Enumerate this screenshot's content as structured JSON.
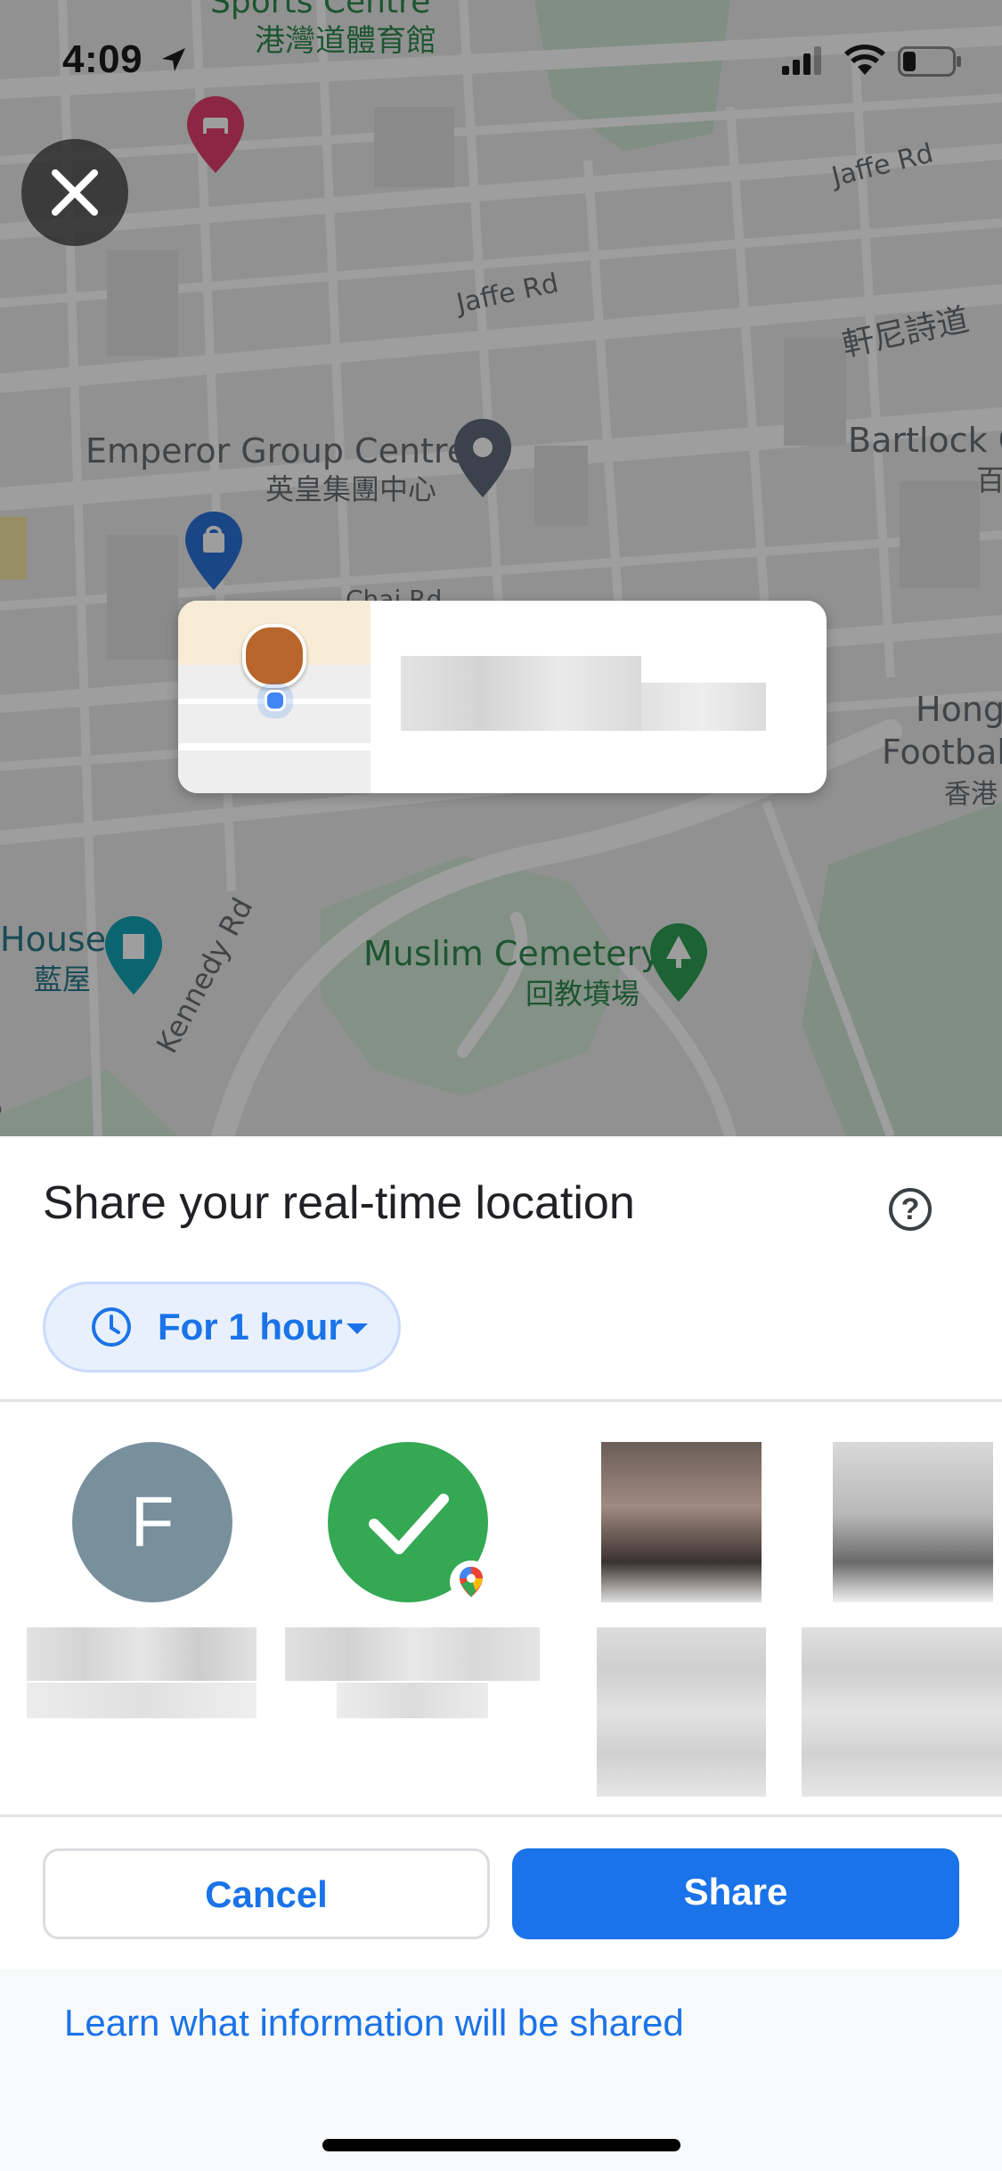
{
  "status_bar": {
    "time": "4:09"
  },
  "map": {
    "labels": {
      "sports_centre_en": "Sports Centre",
      "sports_centre_zh": "港灣道體育館",
      "jaffe_rd_1": "Jaffe Rd",
      "jaffe_rd_2": "Jaffe Rd",
      "hennessy_zh": "軒尼詩道",
      "emperor_en": "Emperor Group Centre",
      "emperor_zh": "英皇集團中心",
      "bartlock": "Bartlock C",
      "bartlock_zh": "百",
      "chui_rd": "Chai Rd",
      "hong": "Hong",
      "footbal": "Footbal",
      "hk_zh": "香港",
      "house_en": "House",
      "house_zh": "藍屋",
      "muslim_en": "Muslim Cemetery",
      "muslim_zh": "回教墳場",
      "kennedy_rd": "Kennedy Rd",
      "kennedy_partial": "edy R"
    }
  },
  "sheet": {
    "title": "Share your real-time location",
    "duration_label": "For 1 hour",
    "contacts": [
      {
        "initial": "F"
      },
      {
        "selected": true
      }
    ],
    "cancel_label": "Cancel",
    "share_label": "Share",
    "learn_link": "Learn what information will be shared"
  },
  "colors": {
    "accent": "#1a73e8",
    "chip_bg": "#e8f0fe",
    "avatar_f": "#78909c",
    "selected_green": "#34a853"
  }
}
